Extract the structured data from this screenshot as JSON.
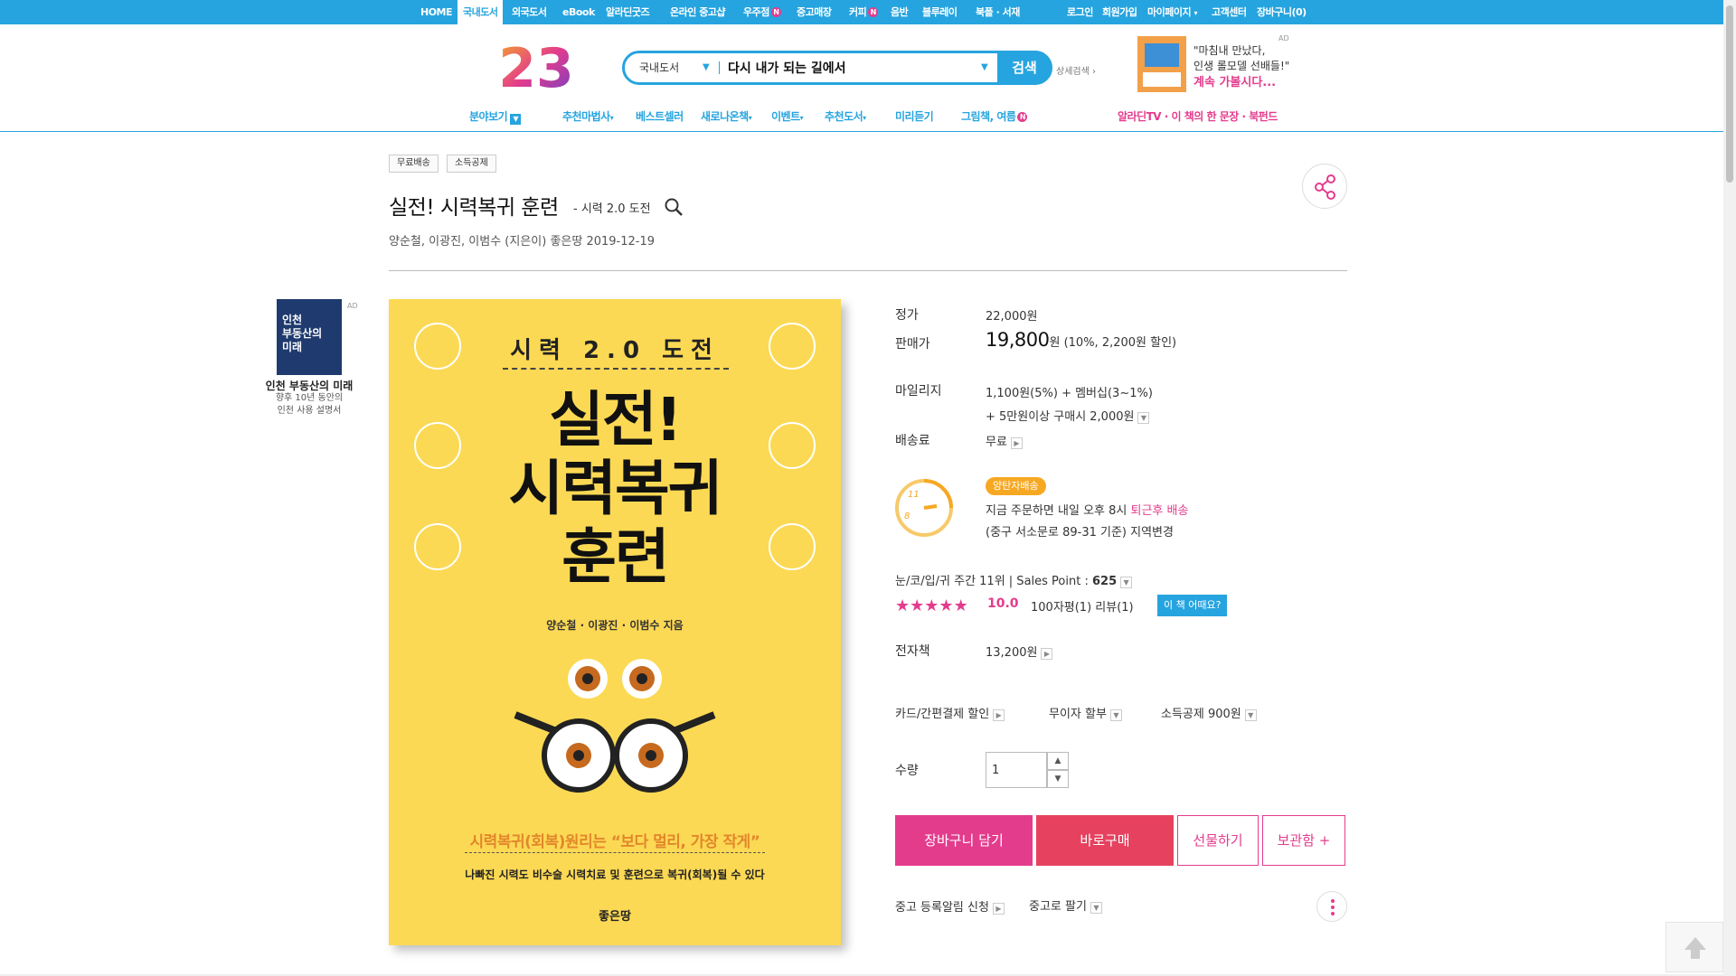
{
  "topbar": {
    "items": [
      "HOME",
      "국내도서",
      "외국도서",
      "eBook",
      "알라딘굿즈",
      "온라인 중고샵",
      "우주점",
      "중고매장",
      "커피",
      "음반",
      "블루레이",
      "북플 · 서재"
    ],
    "right": [
      "로그인",
      "회원가입",
      "마이페이지",
      "고객센터",
      "장바구니(0)"
    ],
    "badge": "N"
  },
  "header": {
    "logo": "23",
    "search_category": "국내도서",
    "search_value": "다시 내가 되는 길에서",
    "search_button": "검색",
    "advanced_search": "상세검색",
    "ad": {
      "tag": "AD",
      "line1": "\"마침내 만났다,",
      "line2": "인생 롤모델 선배들!\"",
      "line3": "계속 가볼시다..."
    }
  },
  "subnav": {
    "items": [
      "분야보기",
      "추천마법사",
      "베스트셀러",
      "새로나온책",
      "이벤트",
      "추천도서",
      "미리듣기",
      "그림책, 여름"
    ],
    "right": "알라딘TV · 이 책의 한 문장 · 북펀드"
  },
  "product": {
    "tags": [
      "무료배송",
      "소득공제"
    ],
    "title": "실전! 시력복귀 훈련",
    "subtitle": "- 시력 2.0 도전",
    "authors": "양순철,  이광진,  이범수 (지은이)  좋은땅  2019-12-19",
    "cover": {
      "top": "시력 2.0 도전",
      "main": "실전!\n시력복귀\n훈련",
      "authors": "양순철 · 이광진 · 이범수 지음",
      "tagline": "시력복귀(회복)원리는 “보다 멀리, 가장 작게”",
      "desc": "나빠진 시력도 비수술 시력치료 및 훈련으로 복귀(회복)될 수 있다",
      "publisher": "좋은땅"
    }
  },
  "side_ad": {
    "tag": "AD",
    "book_text": "인천\n부동산의\n미래",
    "title": "인천 부동산의 미래",
    "desc": "향후 10년 동안의\n인천 사용 설명서"
  },
  "info": {
    "list_price_label": "정가",
    "list_price": "22,000원",
    "sale_price_label": "판매가",
    "sale_price": "19,800",
    "sale_price_unit": "원",
    "discount": "(10%, 2,200원 할인)",
    "mileage_label": "마일리지",
    "mileage": "1,100원(5%) + 멤버십(3~1%)",
    "mileage_extra": "+ 5만원이상 구매시 2,000원",
    "shipping_label": "배송료",
    "shipping": "무료",
    "delivery_badge": "양탄자배송",
    "delivery_text1": "지금 주문하면 내일 오후 8시",
    "delivery_highlight": "퇴근후 배송",
    "delivery_text2": "(중구 서소문로 89-31 기준) 지역변경",
    "rank": "눈/코/입/귀 주간 11위  |  Sales Point :",
    "sales_point": "625",
    "rating": 10.0,
    "rating_text": "10.0",
    "reviews": "100자평(1)   리뷰(1)",
    "review_button": "이 책 어때요?",
    "ebook_label": "전자책",
    "ebook_price": "13,200원",
    "card_discount": "카드/간편결제 할인",
    "installment": "무이자 할부",
    "tax_deduction": "소득공제 900원",
    "qty_label": "수량",
    "qty_value": "1",
    "btn_cart": "장바구니 담기",
    "btn_buy": "바로구매",
    "btn_gift": "선물하기",
    "btn_save": "보관함 +",
    "used_alert": "중고 등록알림 신청",
    "used_sell": "중고로 팔기"
  },
  "colors": {
    "brand_blue": "#26a4df",
    "pink": "#e33c8d",
    "buy_red": "#e6415f",
    "cover_yellow": "#fcd954"
  }
}
